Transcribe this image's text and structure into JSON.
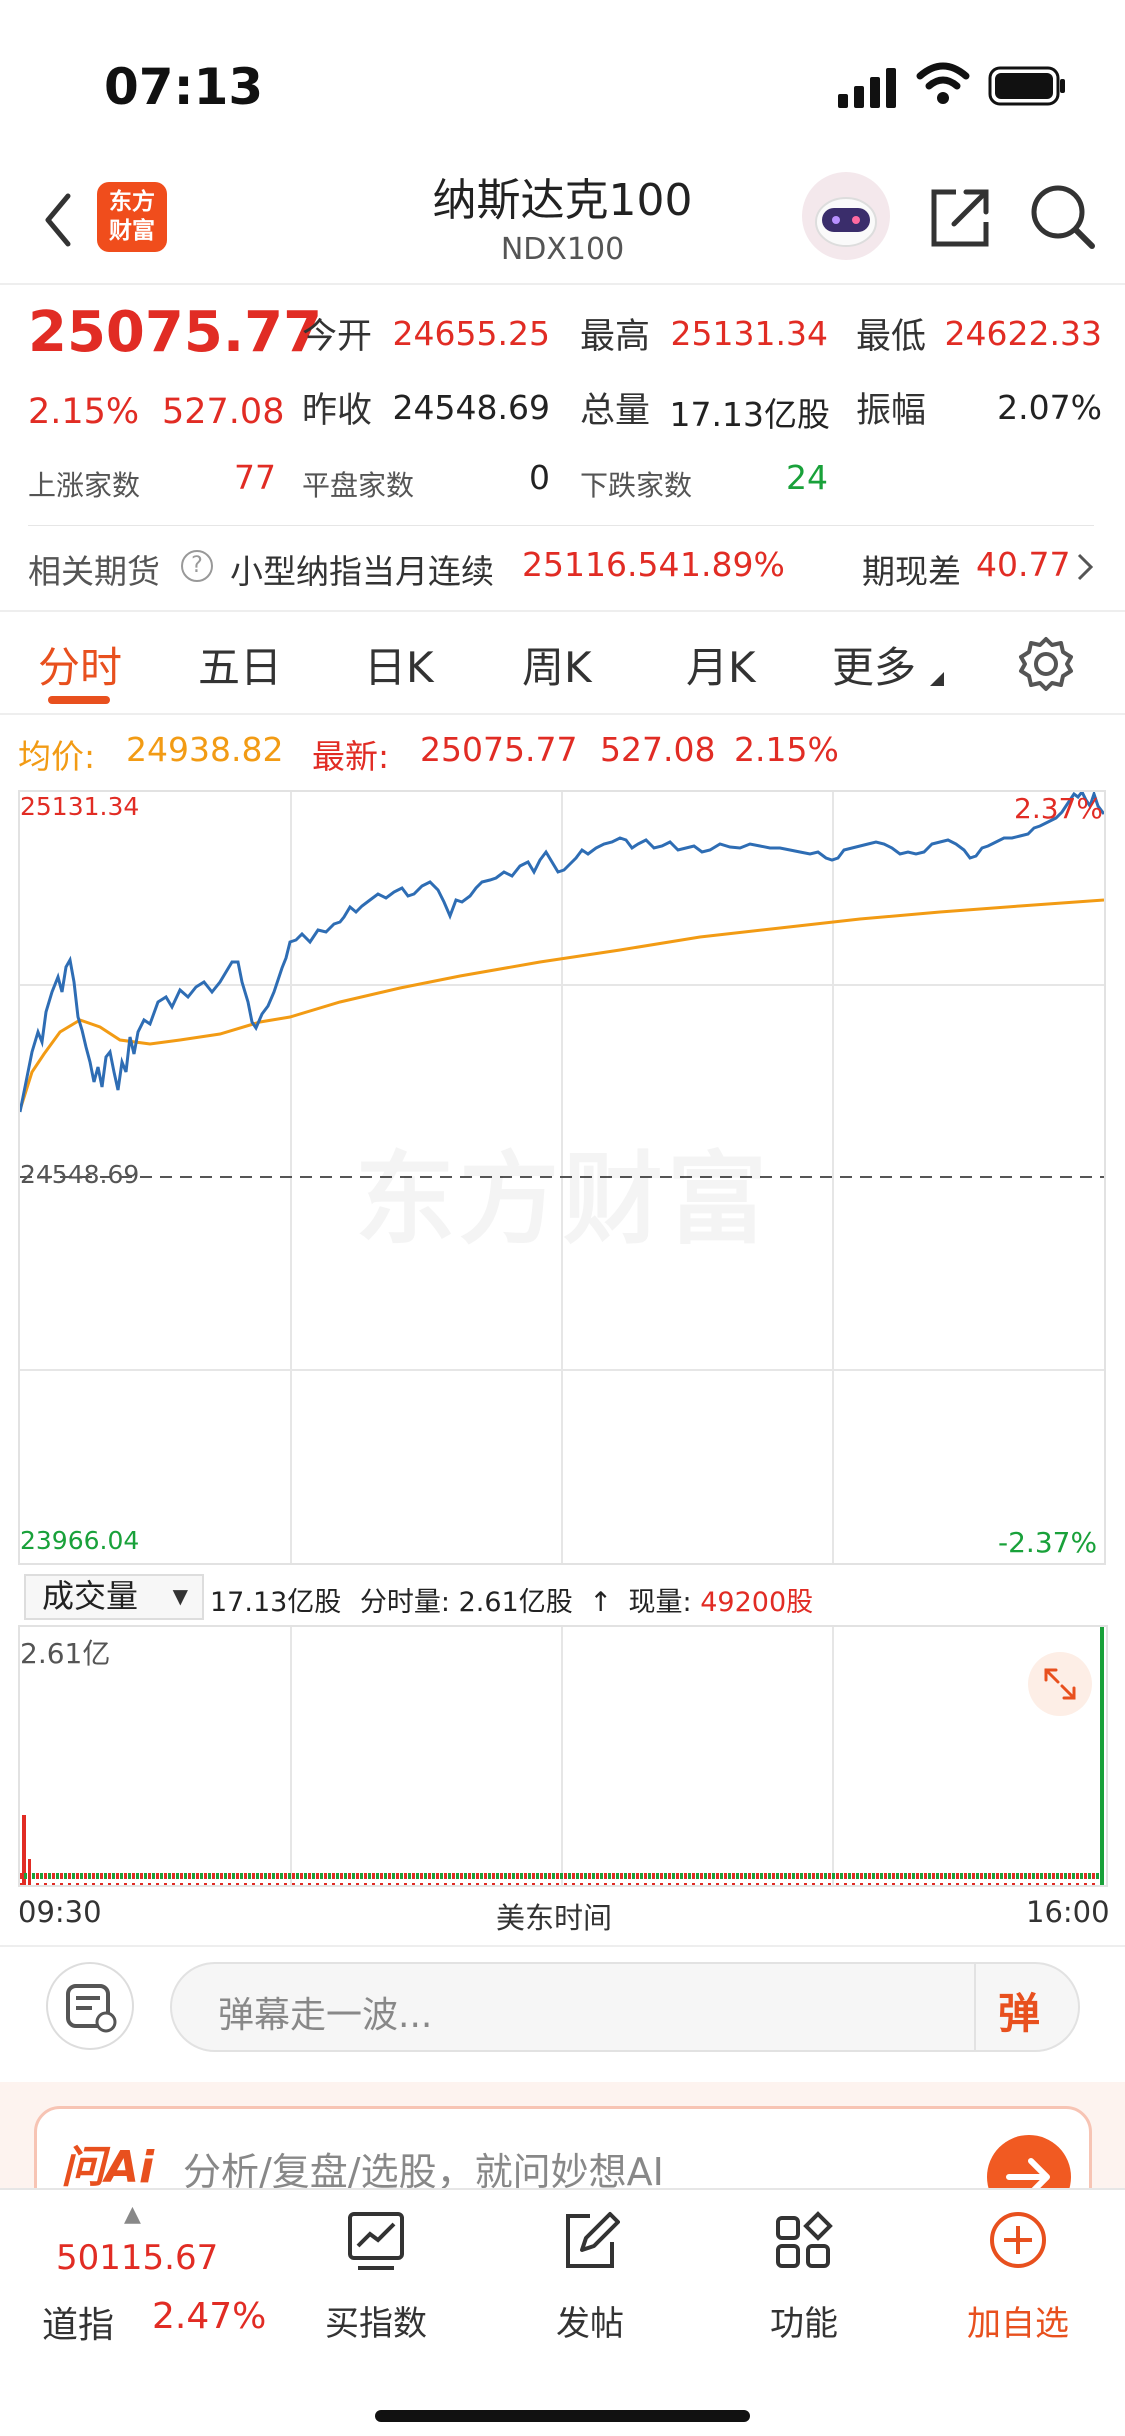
{
  "status": {
    "time": "07:13"
  },
  "header": {
    "logo_line1": "东方",
    "logo_line2": "财富",
    "title": "纳斯达克100",
    "subtitle": "NDX100"
  },
  "quote": {
    "price": "25075.77",
    "change_pct": "2.15%",
    "change_abs": "527.08",
    "open_label": "今开",
    "open": "24655.25",
    "high_label": "最高",
    "high": "25131.34",
    "low_label": "最低",
    "low": "24622.33",
    "prev_close_label": "昨收",
    "prev_close": "24548.69",
    "volume_label": "总量",
    "volume": "17.13亿股",
    "amplitude_label": "振幅",
    "amplitude": "2.07%",
    "up_label": "上涨家数",
    "up": "77",
    "flat_label": "平盘家数",
    "flat": "0",
    "down_label": "下跌家数",
    "down": "24"
  },
  "futures": {
    "label": "相关期货",
    "name": "小型纳指当月连续",
    "price": "25116.54",
    "pct": "1.89%",
    "basis_label": "期现差",
    "basis": "40.77"
  },
  "tabs": [
    "分时",
    "五日",
    "日K",
    "周K",
    "月K",
    "更多"
  ],
  "avg": {
    "avg_label": "均价:",
    "avg_value": "24938.82",
    "last_label": "最新:",
    "last_value": "25075.77",
    "last_change": "527.08",
    "last_pct": "2.15%"
  },
  "chart_labels": {
    "top_left": "25131.34",
    "top_right": "2.37%",
    "mid_left": "24548.69",
    "bottom_left": "23966.04",
    "bottom_right": "-2.37%",
    "watermark": "东方财富"
  },
  "volume": {
    "dropdown": "成交量",
    "total": "17.13亿股",
    "period_label": "分时量:",
    "period_value": "2.61亿股",
    "current_label": "现量:",
    "current_value": "49200股",
    "scale_label": "2.61亿"
  },
  "x_axis": {
    "start": "09:30",
    "middle": "美东时间",
    "end": "16:00"
  },
  "barrage": {
    "placeholder": "弹幕走一波...",
    "send": "弹"
  },
  "ai": {
    "logo": "问Ai",
    "text": "分析/复盘/选股，就问妙想AI"
  },
  "bottom": {
    "index_value": "50115.67",
    "index_name": "道指",
    "index_change": "2.47%",
    "nav": [
      {
        "label": "买指数",
        "icon": "chart-trend-icon"
      },
      {
        "label": "发帖",
        "icon": "edit-icon"
      },
      {
        "label": "功能",
        "icon": "grid-icon"
      },
      {
        "label": "加自选",
        "icon": "plus-circle-icon"
      }
    ]
  },
  "colors": {
    "accent": "#e8501e",
    "up": "#e12c24",
    "down": "#19a13a",
    "price_line": "#2e6db4",
    "avg_line": "#f29b14"
  }
}
